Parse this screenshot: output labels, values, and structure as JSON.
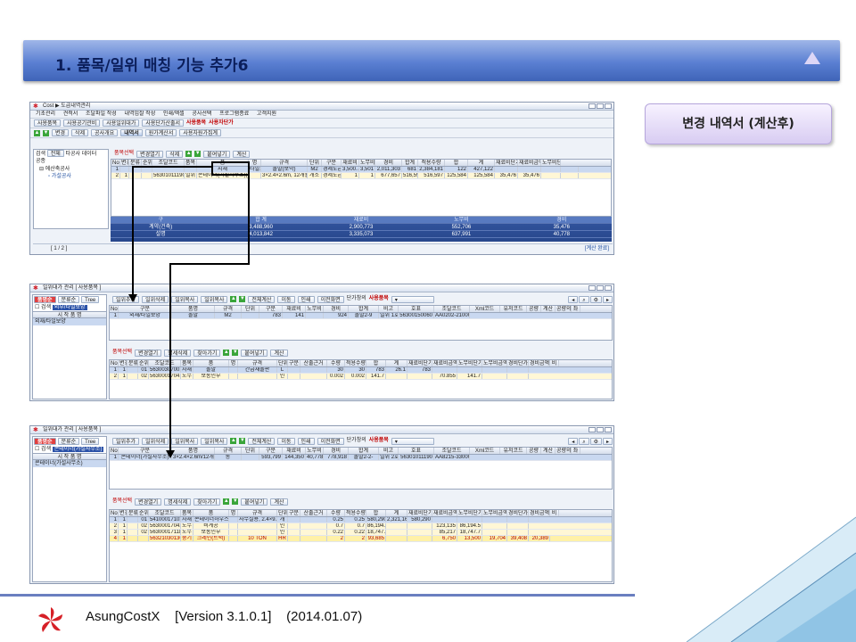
{
  "title": "1. 품목/일위 매칭 기능 추가6",
  "badge": "변경 내역서 (계산후)",
  "footer": {
    "product": "AsungCostX",
    "version": "[Version 3.1.0.1]",
    "date": "(2014.01.07)"
  },
  "win1": {
    "caption": "Cost  ▶ 도급내역관리",
    "menu": [
      "기초관리",
      "견적서",
      "조달파일 작성",
      "내역입찰 작성",
      "인쇄/엑셀",
      "공사선택",
      "프로그램종료",
      "고객지원"
    ],
    "toolbar": [
      "사용품목",
      "사용공기관비",
      "사용일위대가",
      "사용단가산출서",
      "사용품목",
      "사용자단가"
    ],
    "tabs": [
      "변경",
      "삭제",
      "공사개요",
      "내역서",
      "원가계산서",
      "사용자원가집계"
    ],
    "side": {
      "filter_label": "검색",
      "filter_value": "전체",
      "side_label": "타공사 데이터",
      "tree_label": "공종",
      "tree_root": "에산축공사",
      "tree_child": "가설공사"
    },
    "subtabs": [
      "품목선택",
      "변경열기",
      "삭제",
      "붙여넣기",
      "계산"
    ],
    "cols": [
      "No",
      "변경",
      "분류",
      "순위",
      "조달코드",
      "품목",
      "품",
      "명",
      "규격",
      "단위",
      "구분",
      "재료비",
      "노무비",
      "경비",
      "합계",
      "적용수량",
      "합",
      "계",
      "재료비단가",
      "재료비금액",
      "노무비단가",
      "노무비금액",
      "경비단가",
      "경비금액",
      "비고"
    ],
    "rows": [
      [
        "1",
        "",
        "",
        "",
        "",
        "",
        "지재",
        "타일보양",
        "돌발(보막)",
        "M2",
        "경제도급",
        "3,500.7",
        "3,501",
        "2,011,303",
        "681",
        "2,384,181",
        "122",
        "427,122",
        "",
        "",
        "",
        ""
      ],
      [
        "2",
        "1",
        "",
        "",
        "56301011190",
        "일위",
        "콘테이너(가설사무소)(강제)",
        "",
        "3×2.4×2.6m, 12개월",
        "개소",
        "경제도급",
        "1",
        "1",
        "677,657",
        "516,597",
        "516,597",
        "125,584",
        "125,584",
        "35,476",
        "35,476",
        "",
        ""
      ]
    ],
    "sum": {
      "head": [
        "구",
        "합 계",
        "재료비",
        "노무비",
        "경비"
      ],
      "r1": [
        "계약(건축)",
        "3,488,960",
        "2,900,773",
        "552,706",
        "35,476"
      ],
      "r2": [
        "설명",
        "4,013,842",
        "3,335,073",
        "637,991",
        "40,778"
      ]
    },
    "status": "[ 1 / 2 ]",
    "status_right": "[계산 완료]"
  },
  "win2": {
    "caption": "일위대가 관리 [ 사용품목 ]",
    "side_tabs": [
      "품명순",
      "분류순",
      "Tree"
    ],
    "search": "검색",
    "search_value": "외부/타일보양",
    "list_head": "시 작 품 명",
    "list_item": "외재/타일보양",
    "toolbar": [
      "일위추가",
      "일위삭제",
      "일위복사",
      "일위복사",
      "전체계산",
      "이동",
      "인쇄",
      "이전화면",
      "단가창의",
      "사용품목"
    ],
    "top_cols": [
      "No",
      "구분",
      "품명",
      "규격",
      "단위",
      "구분",
      "재료비",
      "노무비",
      "경비",
      "합계",
      "비고",
      "호표",
      "조달코드",
      "Xml코드",
      "유저코드",
      "공량",
      "계산",
      "공량의",
      "좌"
    ],
    "top_row": [
      "1",
      "외재/타일보양",
      "돌발",
      "M2",
      "",
      "783",
      "141",
      "",
      "924",
      "돌발2-9",
      "일위 1호",
      "56300150060",
      "AA0202-210000"
    ],
    "subtabs": [
      "품목선택",
      "변경열기",
      "명세삭제",
      "찾아가기",
      "붙여넣기",
      "계산"
    ],
    "cols": [
      "No",
      "변경",
      "분류",
      "순위",
      "조달코드",
      "품목",
      "품",
      "명",
      "규격",
      "단위",
      "구분",
      "산출근거",
      "수량",
      "적용수량",
      "합",
      "계",
      "재료비단가",
      "재료비금액",
      "노무비단가",
      "노무비금액",
      "경비단가",
      "경비금액",
      "비"
    ],
    "rows": [
      [
        "1",
        "1",
        "",
        "01",
        "56300307001",
        "자재",
        "돌발",
        "",
        "간급재돌판",
        "L",
        "",
        "",
        "30",
        "30",
        "783",
        "26.1",
        "783",
        "",
        "",
        "",
        ""
      ],
      [
        "2",
        "1",
        "",
        "02",
        "56300017041",
        "노무",
        "보통인부",
        "",
        "",
        "인",
        "",
        "",
        "0.002",
        "0.002",
        "141.7",
        "",
        "",
        "70.855",
        "141.7",
        "",
        ""
      ]
    ]
  },
  "win3": {
    "caption": "일위대가 관리 [ 사용품목 ]",
    "side_tabs": [
      "품명순",
      "분류순",
      "Tree"
    ],
    "search": "검색",
    "search_value": "콘테이너(가설사무소)",
    "list_head": "시 작 품 명",
    "list_item": "콘테이너(가설사무소)",
    "toolbar": [
      "일위추가",
      "일위삭제",
      "일위복사",
      "일위복사",
      "전체계산",
      "이동",
      "인쇄",
      "이전화면",
      "단가창의",
      "사용품목"
    ],
    "top_cols": [
      "No",
      "구분",
      "품명",
      "규격",
      "단위",
      "구분",
      "재료비",
      "노무비",
      "경비",
      "합계",
      "비고",
      "호표",
      "조달코드",
      "Xml코드",
      "유저코드",
      "공량",
      "계산",
      "공량의",
      "좌"
    ],
    "top_row": [
      "1",
      "콘테이너(가설사무소)",
      "3×2.4×2.6m/12개월",
      "동",
      "",
      "593,799",
      "144,350",
      "40,778",
      "778,918",
      "돌발2-2-",
      "일위 2호",
      "56301011190",
      "AA8215-330000"
    ],
    "subtabs": [
      "품목선택",
      "변경열기",
      "명세삭제",
      "찾아가기",
      "붙여넣기",
      "계산"
    ],
    "cols": [
      "No",
      "변경",
      "분류",
      "순위",
      "조달코드",
      "품목",
      "품",
      "명",
      "규격",
      "단위",
      "구분",
      "산출근거",
      "수량",
      "적용수량",
      "합",
      "계",
      "재료비단가",
      "재료비금액",
      "노무비단가",
      "노무비금액",
      "경비단가",
      "경비금액",
      "비"
    ],
    "rows": [
      [
        "1",
        "1",
        "",
        "01",
        "54100017103",
        "자재",
        "콘테이너하우스",
        "",
        "사무실용, 2.4×9.0×2.6m",
        "개",
        "",
        "",
        "0.25",
        "0.25",
        "580,290",
        "2,321,160",
        "580,290",
        "",
        "",
        "",
        ""
      ],
      [
        "2",
        "1",
        "",
        "02",
        "56300017042",
        "노무",
        "비계공",
        "",
        "",
        "인",
        "",
        "",
        "0.7",
        "0.7",
        "86,194.5",
        "",
        "",
        "123,135",
        "86,194.5",
        "",
        ""
      ],
      [
        "3",
        "1",
        "",
        "02",
        "56300017118",
        "노무",
        "보통인부",
        "",
        "",
        "인",
        "",
        "",
        "0.22",
        "0.22",
        "18,747.7",
        "",
        "",
        "85,217",
        "18,747.7",
        "",
        ""
      ],
      [
        "4",
        "1",
        "",
        "",
        "56321030130",
        "중기",
        "크레인(트럭)",
        "",
        "10 TON",
        "HR",
        "",
        "",
        "2",
        "2",
        "93,685",
        "",
        "",
        "6,750",
        "13,500",
        "19,704",
        "39,408",
        "20,389"
      ]
    ]
  }
}
